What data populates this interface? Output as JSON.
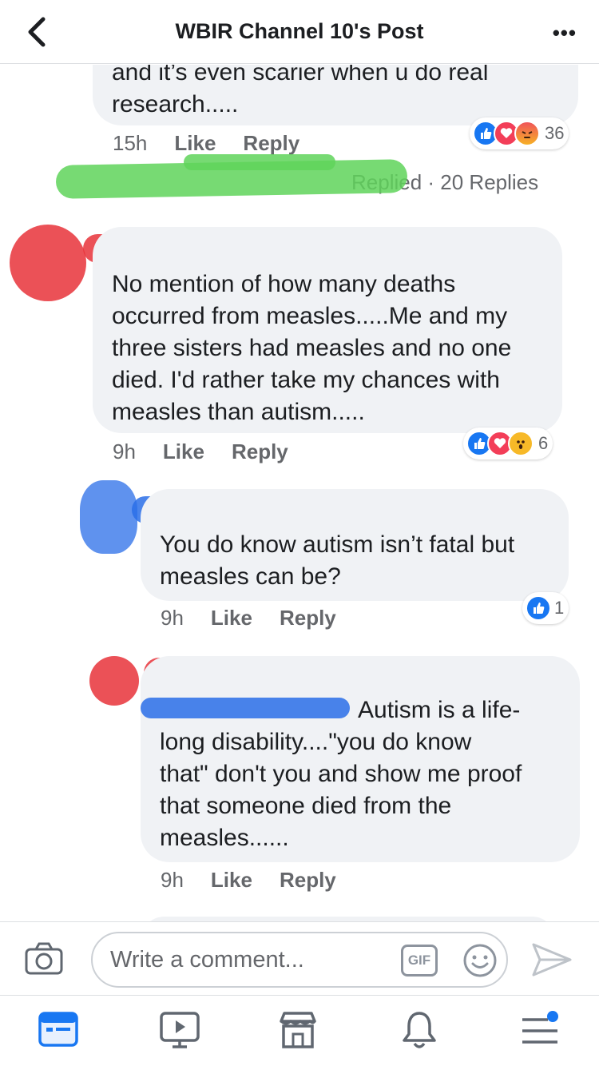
{
  "header": {
    "title": "WBIR Channel 10's Post",
    "more": "•••"
  },
  "comments": {
    "top": {
      "text": "and it’s even scarier when u do real\nresearch.....",
      "time": "15h",
      "like": "Like",
      "reply": "Reply",
      "reaction_count": "36"
    },
    "replied_summary": "Replied · 20 Replies",
    "first": {
      "text": "No mention of how many deaths\noccurred from measles.....Me and my\nthree sisters had measles and no one\ndied. I'd rather take my chances with\nmeasles than autism.....",
      "time": "9h",
      "like": "Like",
      "reply": "Reply",
      "reaction_count": "6"
    },
    "reply1": {
      "text": "You do know autism isn’t fatal but\nmeasles can be?",
      "time": "9h",
      "like": "Like",
      "reply": "Reply",
      "reaction_count": "1"
    },
    "reply2": {
      "text": "Autism is a life-\nlong disability....\"you do know\nthat\" don't you and show me proof\nthat someone died from the\nmeasles......",
      "time": "9h",
      "like": "Like",
      "reply": "Reply"
    }
  },
  "composer": {
    "placeholder": "Write a comment...",
    "gif": "GIF"
  },
  "colors": {
    "facebook_blue": "#1877f2",
    "scribble_red": "#e8323a",
    "scribble_blue": "#2a6ee8",
    "scribble_green": "#5fd35a"
  },
  "icons": [
    "back-arrow-icon",
    "more-icon",
    "like-icon",
    "love-icon",
    "angry-icon",
    "wow-icon",
    "camera-icon",
    "gif-icon",
    "emoji-icon",
    "send-icon",
    "news-feed-icon",
    "watch-icon",
    "marketplace-icon",
    "notifications-icon",
    "menu-icon"
  ]
}
